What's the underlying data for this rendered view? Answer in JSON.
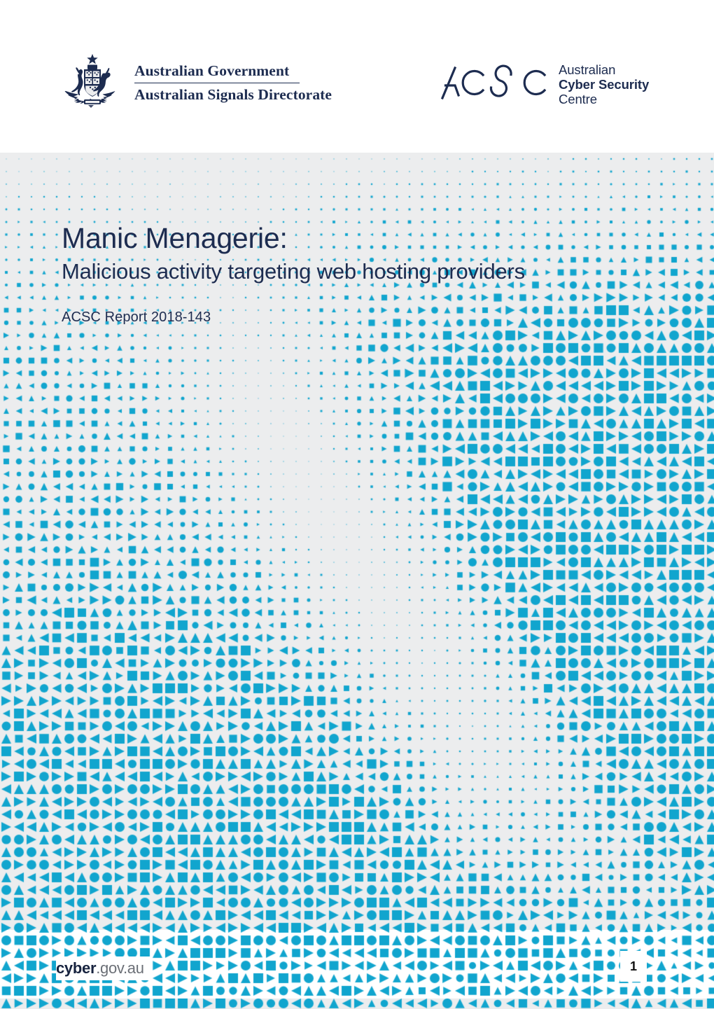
{
  "document": {
    "title_main": "Manic Menagerie:",
    "title_sub": "Malicious activity targeting web hosting providers",
    "report_id": "ACSC Report 2018-143",
    "page_number": "1"
  },
  "masthead": {
    "government_logo": {
      "icon": "australian-coat-of-arms",
      "line1": "Australian Government",
      "line2": "Australian Signals Directorate"
    },
    "acsc_logo": {
      "icon": "acsc-monogram",
      "monogram": "ACSC",
      "line1": "Australian",
      "line2": "Cyber Security",
      "line3": "Centre"
    }
  },
  "footer": {
    "brand_bold": "cyber",
    "brand_light": ".gov.au"
  },
  "colors": {
    "navy": "#1d2c50",
    "cyan": "#11a5ce",
    "panel_grey": "#ecedee",
    "white": "#ffffff",
    "footer_grey": "#6b6f76",
    "page_number_black": "#111111"
  },
  "pattern": {
    "grid_spacing": 18,
    "shape_kinds": [
      "square",
      "circle",
      "triangle-up",
      "triangle-left",
      "triangle-right"
    ],
    "max_shape_size": 14,
    "min_shape_size": 1.2,
    "description": "Halftone grid of cyan geometric shapes whose size follows a density field: dense at lower-left, a secondary lobe at right, and a swooping diagonal band of low density through the centre."
  }
}
